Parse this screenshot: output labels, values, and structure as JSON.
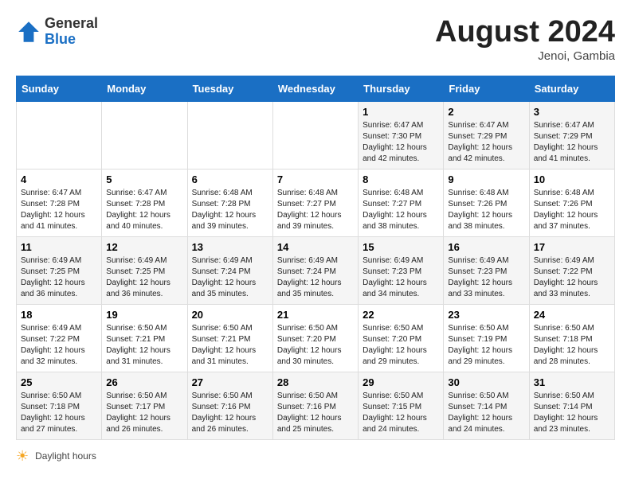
{
  "header": {
    "logo_general": "General",
    "logo_blue": "Blue",
    "month_year": "August 2024",
    "location": "Jenoi, Gambia"
  },
  "days_of_week": [
    "Sunday",
    "Monday",
    "Tuesday",
    "Wednesday",
    "Thursday",
    "Friday",
    "Saturday"
  ],
  "weeks": [
    [
      {
        "day": "",
        "sunrise": "",
        "sunset": "",
        "daylight": ""
      },
      {
        "day": "",
        "sunrise": "",
        "sunset": "",
        "daylight": ""
      },
      {
        "day": "",
        "sunrise": "",
        "sunset": "",
        "daylight": ""
      },
      {
        "day": "",
        "sunrise": "",
        "sunset": "",
        "daylight": ""
      },
      {
        "day": "1",
        "sunrise": "Sunrise: 6:47 AM",
        "sunset": "Sunset: 7:30 PM",
        "daylight": "Daylight: 12 hours and 42 minutes."
      },
      {
        "day": "2",
        "sunrise": "Sunrise: 6:47 AM",
        "sunset": "Sunset: 7:29 PM",
        "daylight": "Daylight: 12 hours and 42 minutes."
      },
      {
        "day": "3",
        "sunrise": "Sunrise: 6:47 AM",
        "sunset": "Sunset: 7:29 PM",
        "daylight": "Daylight: 12 hours and 41 minutes."
      }
    ],
    [
      {
        "day": "4",
        "sunrise": "Sunrise: 6:47 AM",
        "sunset": "Sunset: 7:28 PM",
        "daylight": "Daylight: 12 hours and 41 minutes."
      },
      {
        "day": "5",
        "sunrise": "Sunrise: 6:47 AM",
        "sunset": "Sunset: 7:28 PM",
        "daylight": "Daylight: 12 hours and 40 minutes."
      },
      {
        "day": "6",
        "sunrise": "Sunrise: 6:48 AM",
        "sunset": "Sunset: 7:28 PM",
        "daylight": "Daylight: 12 hours and 39 minutes."
      },
      {
        "day": "7",
        "sunrise": "Sunrise: 6:48 AM",
        "sunset": "Sunset: 7:27 PM",
        "daylight": "Daylight: 12 hours and 39 minutes."
      },
      {
        "day": "8",
        "sunrise": "Sunrise: 6:48 AM",
        "sunset": "Sunset: 7:27 PM",
        "daylight": "Daylight: 12 hours and 38 minutes."
      },
      {
        "day": "9",
        "sunrise": "Sunrise: 6:48 AM",
        "sunset": "Sunset: 7:26 PM",
        "daylight": "Daylight: 12 hours and 38 minutes."
      },
      {
        "day": "10",
        "sunrise": "Sunrise: 6:48 AM",
        "sunset": "Sunset: 7:26 PM",
        "daylight": "Daylight: 12 hours and 37 minutes."
      }
    ],
    [
      {
        "day": "11",
        "sunrise": "Sunrise: 6:49 AM",
        "sunset": "Sunset: 7:25 PM",
        "daylight": "Daylight: 12 hours and 36 minutes."
      },
      {
        "day": "12",
        "sunrise": "Sunrise: 6:49 AM",
        "sunset": "Sunset: 7:25 PM",
        "daylight": "Daylight: 12 hours and 36 minutes."
      },
      {
        "day": "13",
        "sunrise": "Sunrise: 6:49 AM",
        "sunset": "Sunset: 7:24 PM",
        "daylight": "Daylight: 12 hours and 35 minutes."
      },
      {
        "day": "14",
        "sunrise": "Sunrise: 6:49 AM",
        "sunset": "Sunset: 7:24 PM",
        "daylight": "Daylight: 12 hours and 35 minutes."
      },
      {
        "day": "15",
        "sunrise": "Sunrise: 6:49 AM",
        "sunset": "Sunset: 7:23 PM",
        "daylight": "Daylight: 12 hours and 34 minutes."
      },
      {
        "day": "16",
        "sunrise": "Sunrise: 6:49 AM",
        "sunset": "Sunset: 7:23 PM",
        "daylight": "Daylight: 12 hours and 33 minutes."
      },
      {
        "day": "17",
        "sunrise": "Sunrise: 6:49 AM",
        "sunset": "Sunset: 7:22 PM",
        "daylight": "Daylight: 12 hours and 33 minutes."
      }
    ],
    [
      {
        "day": "18",
        "sunrise": "Sunrise: 6:49 AM",
        "sunset": "Sunset: 7:22 PM",
        "daylight": "Daylight: 12 hours and 32 minutes."
      },
      {
        "day": "19",
        "sunrise": "Sunrise: 6:50 AM",
        "sunset": "Sunset: 7:21 PM",
        "daylight": "Daylight: 12 hours and 31 minutes."
      },
      {
        "day": "20",
        "sunrise": "Sunrise: 6:50 AM",
        "sunset": "Sunset: 7:21 PM",
        "daylight": "Daylight: 12 hours and 31 minutes."
      },
      {
        "day": "21",
        "sunrise": "Sunrise: 6:50 AM",
        "sunset": "Sunset: 7:20 PM",
        "daylight": "Daylight: 12 hours and 30 minutes."
      },
      {
        "day": "22",
        "sunrise": "Sunrise: 6:50 AM",
        "sunset": "Sunset: 7:20 PM",
        "daylight": "Daylight: 12 hours and 29 minutes."
      },
      {
        "day": "23",
        "sunrise": "Sunrise: 6:50 AM",
        "sunset": "Sunset: 7:19 PM",
        "daylight": "Daylight: 12 hours and 29 minutes."
      },
      {
        "day": "24",
        "sunrise": "Sunrise: 6:50 AM",
        "sunset": "Sunset: 7:18 PM",
        "daylight": "Daylight: 12 hours and 28 minutes."
      }
    ],
    [
      {
        "day": "25",
        "sunrise": "Sunrise: 6:50 AM",
        "sunset": "Sunset: 7:18 PM",
        "daylight": "Daylight: 12 hours and 27 minutes."
      },
      {
        "day": "26",
        "sunrise": "Sunrise: 6:50 AM",
        "sunset": "Sunset: 7:17 PM",
        "daylight": "Daylight: 12 hours and 26 minutes."
      },
      {
        "day": "27",
        "sunrise": "Sunrise: 6:50 AM",
        "sunset": "Sunset: 7:16 PM",
        "daylight": "Daylight: 12 hours and 26 minutes."
      },
      {
        "day": "28",
        "sunrise": "Sunrise: 6:50 AM",
        "sunset": "Sunset: 7:16 PM",
        "daylight": "Daylight: 12 hours and 25 minutes."
      },
      {
        "day": "29",
        "sunrise": "Sunrise: 6:50 AM",
        "sunset": "Sunset: 7:15 PM",
        "daylight": "Daylight: 12 hours and 24 minutes."
      },
      {
        "day": "30",
        "sunrise": "Sunrise: 6:50 AM",
        "sunset": "Sunset: 7:14 PM",
        "daylight": "Daylight: 12 hours and 24 minutes."
      },
      {
        "day": "31",
        "sunrise": "Sunrise: 6:50 AM",
        "sunset": "Sunset: 7:14 PM",
        "daylight": "Daylight: 12 hours and 23 minutes."
      }
    ]
  ],
  "legend": {
    "label": "Daylight hours"
  }
}
